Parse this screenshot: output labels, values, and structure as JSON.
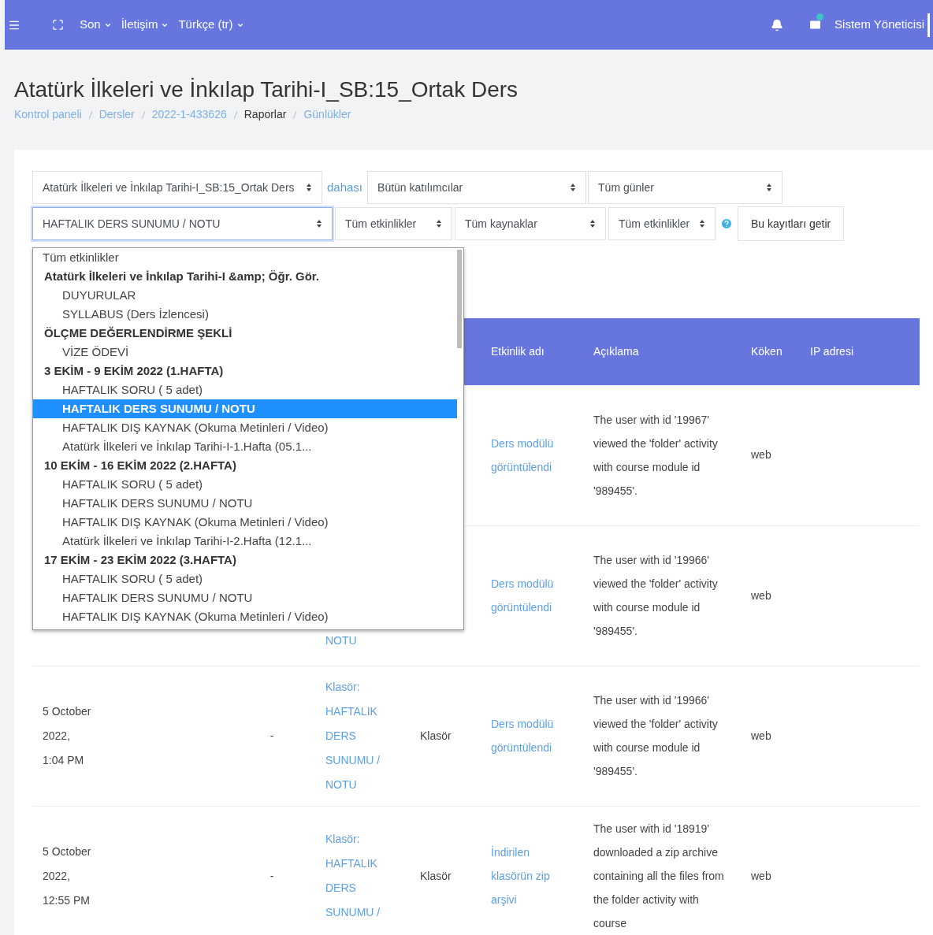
{
  "navbar": {
    "menus": [
      {
        "label": "Son"
      },
      {
        "label": "İletişim"
      },
      {
        "label": "Türkçe (tr)"
      }
    ],
    "user": "Sistem Yöneticisi"
  },
  "page": {
    "title": "Atatürk İlkeleri ve İnkılap Tarihi-I_SB:15_Ortak Ders",
    "breadcrumb": [
      {
        "label": "Kontrol paneli",
        "link": true
      },
      {
        "label": "Dersler",
        "link": true
      },
      {
        "label": "2022-1-433626",
        "link": true
      },
      {
        "label": "Raporlar",
        "link": false
      },
      {
        "label": "Günlükler",
        "link": true
      }
    ]
  },
  "filters": {
    "row_1": [
      {
        "kind": "select",
        "value": "Atatürk İlkeleri ve İnkılap Tarihi-I_SB:15_Ortak Ders"
      },
      {
        "kind": "link",
        "value": "dahası"
      },
      {
        "kind": "select",
        "value": "Bütün katılımcılar"
      },
      {
        "kind": "select",
        "value": "Tüm günler"
      }
    ],
    "row_2": [
      {
        "kind": "select",
        "value": "HAFTALIK DERS SUNUMU / NOTU",
        "focused": true
      },
      {
        "kind": "select",
        "value": "Tüm etkinlikler",
        "focused": false
      },
      {
        "kind": "select",
        "value": "Tüm kaynaklar",
        "focused": false
      },
      {
        "kind": "select",
        "value": "Tüm etkinlikler",
        "focused": false
      },
      {
        "kind": "help"
      },
      {
        "kind": "button",
        "value": "Bu kayıtları getir"
      }
    ]
  },
  "dropdown": [
    {
      "kind": "option",
      "label": "Tüm etkinlikler",
      "selected": false
    },
    {
      "kind": "group",
      "label": "Atatürk İlkeleri ve İnkılap Tarihi-I &amp; Öğr. Gör.",
      "children": [
        {
          "label": "DUYURULAR",
          "selected": false
        },
        {
          "label": "SYLLABUS (Ders İzlencesi)",
          "selected": false
        }
      ]
    },
    {
      "kind": "group",
      "label": "ÖLÇME DEĞERLENDİRME ŞEKLİ",
      "children": [
        {
          "label": "VİZE ÖDEVİ",
          "selected": false
        }
      ]
    },
    {
      "kind": "group",
      "label": "3 EKİM - 9 EKİM 2022 (1.HAFTA)",
      "children": [
        {
          "label": "HAFTALIK SORU ( 5 adet)",
          "selected": false
        },
        {
          "label": "HAFTALIK DERS SUNUMU / NOTU",
          "selected": true
        },
        {
          "label": "HAFTALIK DIŞ KAYNAK (Okuma Metinleri / Video)",
          "selected": false
        },
        {
          "label": "Atatürk İlkeleri ve İnkılap Tarihi-I-1.Hafta (05.1...",
          "selected": false
        }
      ]
    },
    {
      "kind": "group",
      "label": "10 EKİM - 16 EKİM 2022 (2.HAFTA)",
      "children": [
        {
          "label": "HAFTALIK SORU ( 5 adet)",
          "selected": false
        },
        {
          "label": "HAFTALIK DERS SUNUMU / NOTU",
          "selected": false
        },
        {
          "label": "HAFTALIK DIŞ KAYNAK (Okuma Metinleri / Video)",
          "selected": false
        },
        {
          "label": "Atatürk İlkeleri ve İnkılap Tarihi-I-2.Hafta (12.1...",
          "selected": false
        }
      ]
    },
    {
      "kind": "group",
      "label": "17 EKİM - 23 EKİM 2022 (3.HAFTA)",
      "children": [
        {
          "label": "HAFTALIK SORU ( 5 adet)",
          "selected": false
        },
        {
          "label": "HAFTALIK DERS SUNUMU / NOTU",
          "selected": false
        },
        {
          "label": "HAFTALIK DIŞ KAYNAK (Okuma Metinleri / Video)",
          "selected": false
        }
      ]
    }
  ],
  "table": {
    "columns": [
      "Etkinlik adı",
      "Açıklama",
      "Köken",
      "IP adresi"
    ],
    "rows": [
      {
        "event": "Ders modülü görüntülendi",
        "description": "The user with id '19967' viewed the 'folder' activity with course module id '989455'.",
        "origin": "web"
      },
      {
        "context": "NOTU",
        "event": "Ders modülü görüntülendi",
        "description": "The user with id '19966' viewed the 'folder' activity with course module id '989455'.",
        "origin": "web"
      },
      {
        "time": "5 October 2022, 1:04 PM",
        "affected": "-",
        "context": "Klasör: HAFTALIK DERS SUNUMU / NOTU",
        "component": "Klasör",
        "event": "Ders modülü görüntülendi",
        "description": "The user with id '19966' viewed the 'folder' activity with course module id '989455'.",
        "origin": "web"
      },
      {
        "time": "5 October 2022, 12:55 PM",
        "affected": "-",
        "context": "Klasör: HAFTALIK DERS SUNUMU /",
        "component": "Klasör",
        "event": "İndirilen klasörün zip arşivi",
        "description": "The user with id '18919' downloaded a zip archive containing all the files from the folder activity with course",
        "origin": "web"
      }
    ]
  }
}
